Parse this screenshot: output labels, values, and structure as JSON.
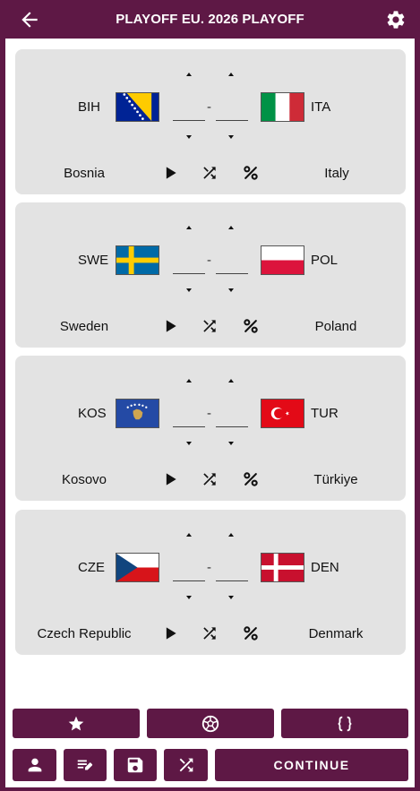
{
  "header": {
    "title": "PLAYOFF EU. 2026 PLAYOFF",
    "back_icon": "arrow-left-icon",
    "settings_icon": "gear-icon"
  },
  "matches": [
    {
      "home": {
        "code": "BIH",
        "name": "Bosnia",
        "flag": "bosnia-flag"
      },
      "away": {
        "code": "ITA",
        "name": "Italy",
        "flag": "italy-flag"
      },
      "home_score": "",
      "away_score": "",
      "separator": "-"
    },
    {
      "home": {
        "code": "SWE",
        "name": "Sweden",
        "flag": "sweden-flag"
      },
      "away": {
        "code": "POL",
        "name": "Poland",
        "flag": "poland-flag"
      },
      "home_score": "",
      "away_score": "",
      "separator": "-"
    },
    {
      "home": {
        "code": "KOS",
        "name": "Kosovo",
        "flag": "kosovo-flag"
      },
      "away": {
        "code": "TUR",
        "name": "Türkiye",
        "flag": "turkey-flag"
      },
      "home_score": "",
      "away_score": "",
      "separator": "-"
    },
    {
      "home": {
        "code": "CZE",
        "name": "Czech Republic",
        "flag": "czech-flag"
      },
      "away": {
        "code": "DEN",
        "name": "Denmark",
        "flag": "denmark-flag"
      },
      "home_score": "",
      "away_score": "",
      "separator": "-"
    }
  ],
  "toolbar_top": [
    "star-icon",
    "soccer-ball-icon",
    "braces-icon"
  ],
  "toolbar_bottom": [
    "person-icon",
    "edit-list-icon",
    "save-icon",
    "shuffle-icon"
  ],
  "continue_label": "CONTINUE",
  "colors": {
    "brand": "#5e1845",
    "card_bg": "#e3e3e3",
    "background": "#ffffff"
  }
}
